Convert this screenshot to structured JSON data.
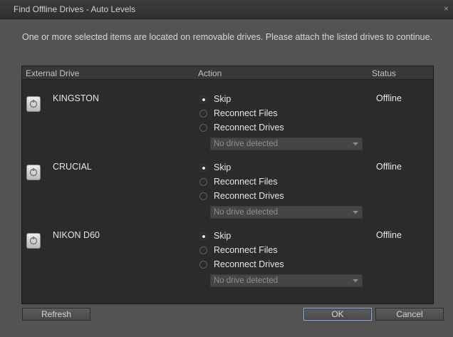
{
  "window": {
    "title": "Find Offline Drives - Auto Levels",
    "close_glyph": "×"
  },
  "message": "One or more selected items are located on removable drives.  Please attach the listed drives to continue.",
  "table": {
    "headers": {
      "drive": "External Drive",
      "action": "Action",
      "status": "Status"
    },
    "rows": [
      {
        "name": "KINGSTON",
        "status": "Offline",
        "options": [
          "Skip",
          "Reconnect Files",
          "Reconnect Drives"
        ],
        "selected": "Skip",
        "dropdown": "No drive detected"
      },
      {
        "name": "CRUCIAL",
        "status": "Offline",
        "options": [
          "Skip",
          "Reconnect Files",
          "Reconnect Drives"
        ],
        "selected": "Skip",
        "dropdown": "No drive detected"
      },
      {
        "name": "NIKON D60",
        "status": "Offline",
        "options": [
          "Skip",
          "Reconnect Files",
          "Reconnect Drives"
        ],
        "selected": "Skip",
        "dropdown": "No drive detected"
      }
    ]
  },
  "buttons": {
    "refresh": "Refresh",
    "ok": "OK",
    "cancel": "Cancel"
  },
  "icons": {
    "drive": "removable-drive-icon",
    "close": "close-icon",
    "dropdown": "chevron-down-icon"
  },
  "colors": {
    "background": "#535353",
    "panel": "#2b2b2b",
    "ok_focus": "#8fb0d8"
  }
}
